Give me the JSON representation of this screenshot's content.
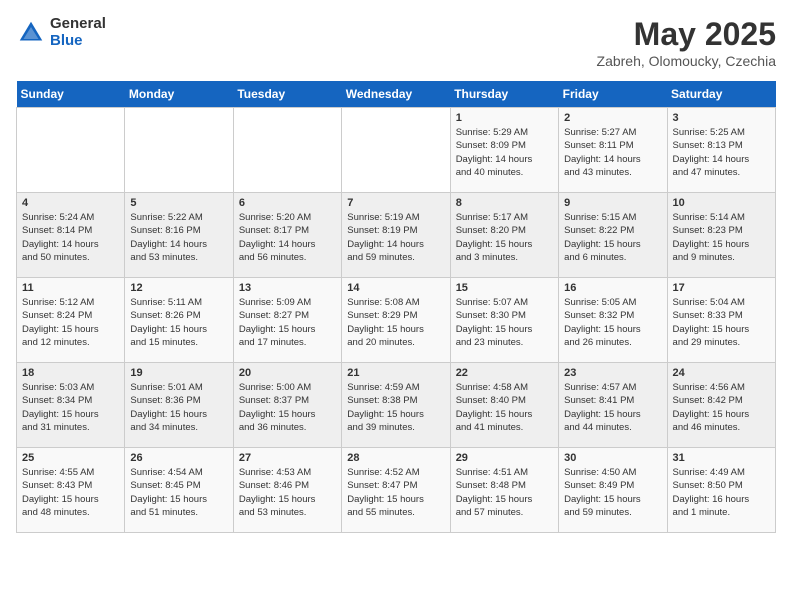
{
  "logo": {
    "general": "General",
    "blue": "Blue"
  },
  "title": "May 2025",
  "subtitle": "Zabreh, Olomoucky, Czechia",
  "days_header": [
    "Sunday",
    "Monday",
    "Tuesday",
    "Wednesday",
    "Thursday",
    "Friday",
    "Saturday"
  ],
  "weeks": [
    [
      {
        "day": "",
        "info": ""
      },
      {
        "day": "",
        "info": ""
      },
      {
        "day": "",
        "info": ""
      },
      {
        "day": "",
        "info": ""
      },
      {
        "day": "1",
        "info": "Sunrise: 5:29 AM\nSunset: 8:09 PM\nDaylight: 14 hours\nand 40 minutes."
      },
      {
        "day": "2",
        "info": "Sunrise: 5:27 AM\nSunset: 8:11 PM\nDaylight: 14 hours\nand 43 minutes."
      },
      {
        "day": "3",
        "info": "Sunrise: 5:25 AM\nSunset: 8:13 PM\nDaylight: 14 hours\nand 47 minutes."
      }
    ],
    [
      {
        "day": "4",
        "info": "Sunrise: 5:24 AM\nSunset: 8:14 PM\nDaylight: 14 hours\nand 50 minutes."
      },
      {
        "day": "5",
        "info": "Sunrise: 5:22 AM\nSunset: 8:16 PM\nDaylight: 14 hours\nand 53 minutes."
      },
      {
        "day": "6",
        "info": "Sunrise: 5:20 AM\nSunset: 8:17 PM\nDaylight: 14 hours\nand 56 minutes."
      },
      {
        "day": "7",
        "info": "Sunrise: 5:19 AM\nSunset: 8:19 PM\nDaylight: 14 hours\nand 59 minutes."
      },
      {
        "day": "8",
        "info": "Sunrise: 5:17 AM\nSunset: 8:20 PM\nDaylight: 15 hours\nand 3 minutes."
      },
      {
        "day": "9",
        "info": "Sunrise: 5:15 AM\nSunset: 8:22 PM\nDaylight: 15 hours\nand 6 minutes."
      },
      {
        "day": "10",
        "info": "Sunrise: 5:14 AM\nSunset: 8:23 PM\nDaylight: 15 hours\nand 9 minutes."
      }
    ],
    [
      {
        "day": "11",
        "info": "Sunrise: 5:12 AM\nSunset: 8:24 PM\nDaylight: 15 hours\nand 12 minutes."
      },
      {
        "day": "12",
        "info": "Sunrise: 5:11 AM\nSunset: 8:26 PM\nDaylight: 15 hours\nand 15 minutes."
      },
      {
        "day": "13",
        "info": "Sunrise: 5:09 AM\nSunset: 8:27 PM\nDaylight: 15 hours\nand 17 minutes."
      },
      {
        "day": "14",
        "info": "Sunrise: 5:08 AM\nSunset: 8:29 PM\nDaylight: 15 hours\nand 20 minutes."
      },
      {
        "day": "15",
        "info": "Sunrise: 5:07 AM\nSunset: 8:30 PM\nDaylight: 15 hours\nand 23 minutes."
      },
      {
        "day": "16",
        "info": "Sunrise: 5:05 AM\nSunset: 8:32 PM\nDaylight: 15 hours\nand 26 minutes."
      },
      {
        "day": "17",
        "info": "Sunrise: 5:04 AM\nSunset: 8:33 PM\nDaylight: 15 hours\nand 29 minutes."
      }
    ],
    [
      {
        "day": "18",
        "info": "Sunrise: 5:03 AM\nSunset: 8:34 PM\nDaylight: 15 hours\nand 31 minutes."
      },
      {
        "day": "19",
        "info": "Sunrise: 5:01 AM\nSunset: 8:36 PM\nDaylight: 15 hours\nand 34 minutes."
      },
      {
        "day": "20",
        "info": "Sunrise: 5:00 AM\nSunset: 8:37 PM\nDaylight: 15 hours\nand 36 minutes."
      },
      {
        "day": "21",
        "info": "Sunrise: 4:59 AM\nSunset: 8:38 PM\nDaylight: 15 hours\nand 39 minutes."
      },
      {
        "day": "22",
        "info": "Sunrise: 4:58 AM\nSunset: 8:40 PM\nDaylight: 15 hours\nand 41 minutes."
      },
      {
        "day": "23",
        "info": "Sunrise: 4:57 AM\nSunset: 8:41 PM\nDaylight: 15 hours\nand 44 minutes."
      },
      {
        "day": "24",
        "info": "Sunrise: 4:56 AM\nSunset: 8:42 PM\nDaylight: 15 hours\nand 46 minutes."
      }
    ],
    [
      {
        "day": "25",
        "info": "Sunrise: 4:55 AM\nSunset: 8:43 PM\nDaylight: 15 hours\nand 48 minutes."
      },
      {
        "day": "26",
        "info": "Sunrise: 4:54 AM\nSunset: 8:45 PM\nDaylight: 15 hours\nand 51 minutes."
      },
      {
        "day": "27",
        "info": "Sunrise: 4:53 AM\nSunset: 8:46 PM\nDaylight: 15 hours\nand 53 minutes."
      },
      {
        "day": "28",
        "info": "Sunrise: 4:52 AM\nSunset: 8:47 PM\nDaylight: 15 hours\nand 55 minutes."
      },
      {
        "day": "29",
        "info": "Sunrise: 4:51 AM\nSunset: 8:48 PM\nDaylight: 15 hours\nand 57 minutes."
      },
      {
        "day": "30",
        "info": "Sunrise: 4:50 AM\nSunset: 8:49 PM\nDaylight: 15 hours\nand 59 minutes."
      },
      {
        "day": "31",
        "info": "Sunrise: 4:49 AM\nSunset: 8:50 PM\nDaylight: 16 hours\nand 1 minute."
      }
    ]
  ]
}
